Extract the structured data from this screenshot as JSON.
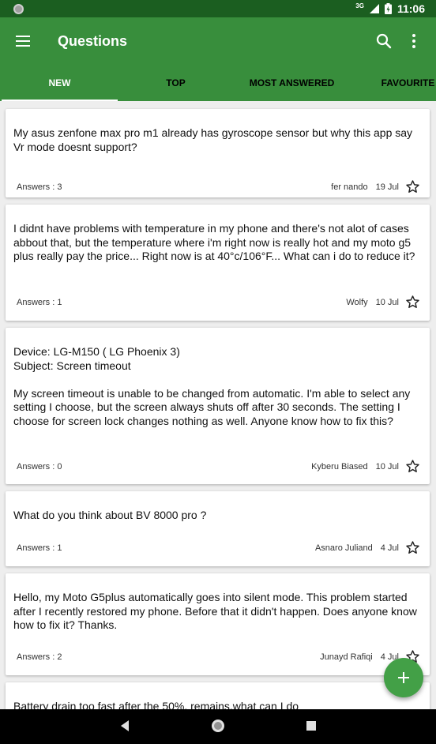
{
  "status_bar": {
    "network": "3G",
    "time": "11:06"
  },
  "app_bar": {
    "title": "Questions"
  },
  "tabs": [
    {
      "label": "NEW",
      "active": true
    },
    {
      "label": "TOP",
      "active": false
    },
    {
      "label": "MOST ANSWERED",
      "active": false
    },
    {
      "label": "FAVOURITE",
      "active": false
    }
  ],
  "questions": [
    {
      "text": "My asus zenfone max pro m1 already has gyroscope sensor but why this app say Vr mode doesnt support?",
      "answers": "Answers : 3",
      "author": "fer nando",
      "date": "19 Jul",
      "starred": false
    },
    {
      "text": "I didnt have problems with temperature in my phone and there's not alot of cases abbout that, but the temperature where i'm right now is really hot and my moto g5 plus really pay the price... Right now is at 40°c/106°F... What can i do to reduce it?",
      "answers": "Answers : 1",
      "author": "Wolfy",
      "date": "10 Jul",
      "starred": false
    },
    {
      "text": "Device: LG-M150 ( LG Phoenix 3)\nSubject: Screen timeout\n\nMy screen timeout is unable to be changed from automatic. I'm able to select any setting I choose, but the screen always shuts off after 30 seconds. The setting I choose for screen lock changes nothing as well. Anyone know how to fix this?",
      "answers": "Answers : 0",
      "author": "Kyberu Biased",
      "date": "10 Jul",
      "starred": false
    },
    {
      "text": "What do you think about BV 8000 pro ?",
      "answers": "Answers : 1",
      "author": "Asnaro Juliand",
      "date": "4 Jul",
      "starred": false
    },
    {
      "text": "Hello, my Moto G5plus automatically goes into silent mode. This problem started after I recently restored my phone. Before that it didn't happen. Does anyone know how to fix it? Thanks.",
      "answers": "Answers : 2",
      "author": "Junayd Rafiqi",
      "date": "4 Jul",
      "starred": false
    },
    {
      "text": "Battery drain too fast after the 50%, remains.what can I do",
      "answers": "",
      "author": "",
      "date": "",
      "starred": false
    }
  ],
  "icons": {
    "menu": "menu-icon",
    "search": "search-icon",
    "more": "more-vert-icon",
    "star": "star-outline-icon",
    "add": "add-icon",
    "back": "back-icon",
    "home": "home-icon",
    "recents": "recents-icon"
  },
  "colors": {
    "primary": "#388e3c",
    "primary_dark": "#1b5e20",
    "accent": "#43a047"
  }
}
